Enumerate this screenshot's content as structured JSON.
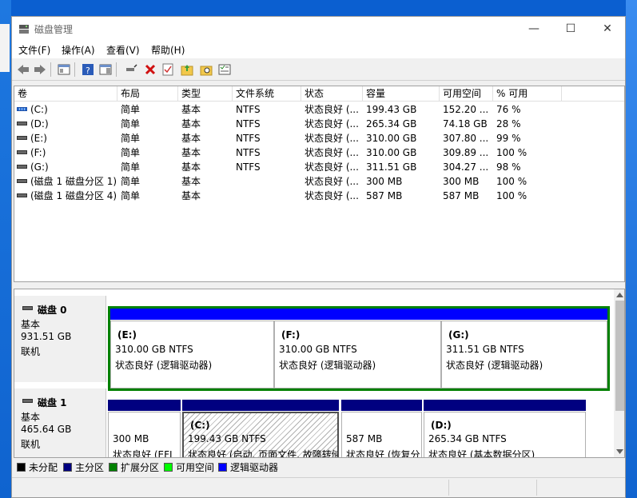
{
  "window": {
    "title": "磁盘管理",
    "controls": {
      "minimize": "—",
      "maximize": "☐",
      "close": "✕"
    }
  },
  "menu": [
    "文件(F)",
    "操作(A)",
    "查看(V)",
    "帮助(H)"
  ],
  "toolbar": {
    "icons": [
      "back-arrow-icon",
      "forward-arrow-icon",
      "console-tree-icon",
      "help-icon",
      "properties-panel-icon",
      "connect-icon",
      "delete-icon",
      "check-icon",
      "new-folder-up-icon",
      "search-folder-icon",
      "properties-list-icon"
    ]
  },
  "columns": [
    "卷",
    "布局",
    "类型",
    "文件系统",
    "状态",
    "容量",
    "可用空间",
    "% 可用"
  ],
  "volumes": [
    {
      "name": "(C:)",
      "layout": "简单",
      "type": "基本",
      "fs": "NTFS",
      "status": "状态良好 (...",
      "capacity": "199.43 GB",
      "free": "152.20 ...",
      "pct": "76 %",
      "icon": "blue"
    },
    {
      "name": "(D:)",
      "layout": "简单",
      "type": "基本",
      "fs": "NTFS",
      "status": "状态良好 (...",
      "capacity": "265.34 GB",
      "free": "74.18 GB",
      "pct": "28 %",
      "icon": "gray"
    },
    {
      "name": "(E:)",
      "layout": "简单",
      "type": "基本",
      "fs": "NTFS",
      "status": "状态良好 (...",
      "capacity": "310.00 GB",
      "free": "307.80 ...",
      "pct": "99 %",
      "icon": "gray"
    },
    {
      "name": "(F:)",
      "layout": "简单",
      "type": "基本",
      "fs": "NTFS",
      "status": "状态良好 (...",
      "capacity": "310.00 GB",
      "free": "309.89 ...",
      "pct": "100 %",
      "icon": "gray"
    },
    {
      "name": "(G:)",
      "layout": "简单",
      "type": "基本",
      "fs": "NTFS",
      "status": "状态良好 (...",
      "capacity": "311.51 GB",
      "free": "304.27 ...",
      "pct": "98 %",
      "icon": "gray"
    },
    {
      "name": "(磁盘 1 磁盘分区 1)",
      "layout": "简单",
      "type": "基本",
      "fs": "",
      "status": "状态良好 (...",
      "capacity": "300 MB",
      "free": "300 MB",
      "pct": "100 %",
      "icon": "gray"
    },
    {
      "name": "(磁盘 1 磁盘分区 4)",
      "layout": "简单",
      "type": "基本",
      "fs": "",
      "status": "状态良好 (...",
      "capacity": "587 MB",
      "free": "587 MB",
      "pct": "100 %",
      "icon": "gray"
    }
  ],
  "disks": [
    {
      "name": "磁盘 0",
      "type": "基本",
      "size": "931.51 GB",
      "state": "联机",
      "partitions": [
        {
          "name": "(E:)",
          "size": "310.00 GB NTFS",
          "status": "状态良好 (逻辑驱动器)"
        },
        {
          "name": "(F:)",
          "size": "310.00 GB NTFS",
          "status": "状态良好 (逻辑驱动器)"
        },
        {
          "name": "(G:)",
          "size": "311.51 GB NTFS",
          "status": "状态良好 (逻辑驱动器)"
        }
      ]
    },
    {
      "name": "磁盘 1",
      "type": "基本",
      "size": "465.64 GB",
      "state": "联机",
      "partitions": [
        {
          "name": "",
          "size": "300 MB",
          "status": "状态良好 (EFI"
        },
        {
          "name": "(C:)",
          "size": "199.43 GB NTFS",
          "status": "状态良好 (启动, 页面文件, 故障转储"
        },
        {
          "name": "",
          "size": "587 MB",
          "status": "状态良好 (恢复分"
        },
        {
          "name": "(D:)",
          "size": "265.34 GB NTFS",
          "status": "状态良好 (基本数据分区)"
        }
      ]
    }
  ],
  "legend": [
    {
      "label": "未分配",
      "color": "#000000"
    },
    {
      "label": "主分区",
      "color": "#000080"
    },
    {
      "label": "扩展分区",
      "color": "#008000"
    },
    {
      "label": "可用空间",
      "color": "#00ff00"
    },
    {
      "label": "逻辑驱动器",
      "color": "#0000ff"
    }
  ],
  "colors": {
    "primary_bar": "#000080",
    "logical_bar": "#0000ff",
    "extended_border": "#008000"
  }
}
